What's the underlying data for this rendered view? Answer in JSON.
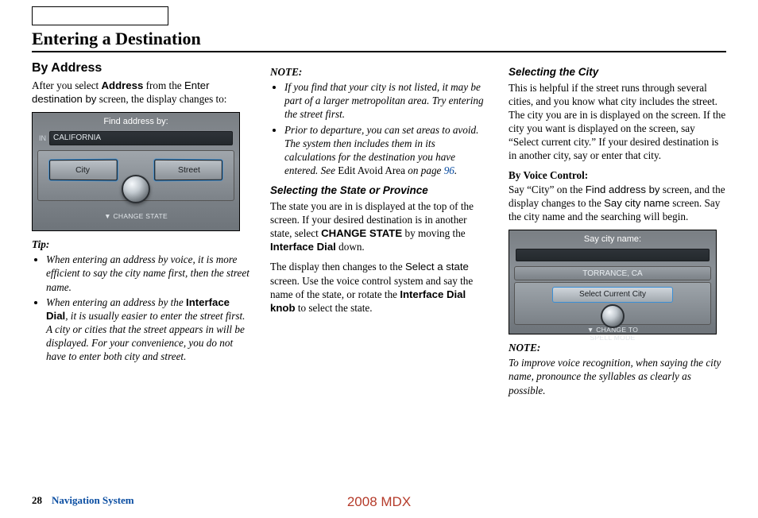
{
  "title": "Entering a Destination",
  "col1": {
    "heading": "By Address",
    "intro_1": "After you select ",
    "intro_bold": "Address",
    "intro_2": " from the ",
    "intro_sans": "Enter destination by",
    "intro_3": " screen, the display changes to:",
    "device": {
      "header": "Find address by:",
      "in_label": "IN",
      "state": "CALIFORNIA",
      "btn_city": "City",
      "btn_street": "Street",
      "footer": "▼ CHANGE STATE"
    },
    "tip_label": "Tip:",
    "tips": [
      "When entering an address by voice, it is more efficient to say the city name first, then the street name.",
      {
        "pre": "When entering an address by the ",
        "bold": "Interface Dial",
        "post": ", it is usually easier to enter the street first. A city or cities that the street appears in will be displayed. For your convenience, you do not have to enter both city and street."
      }
    ]
  },
  "col2": {
    "note_label": "NOTE:",
    "notes": [
      "If you find that your city is not listed, it may be part of a larger metropolitan area. Try entering the street first.",
      {
        "pre": "Prior to departure, you can set areas to avoid. The system then includes them in its calculations for the destination you have entered. See ",
        "roman": "Edit Avoid Area",
        "post_italic": " on page ",
        "link": "96",
        "end": "."
      }
    ],
    "sub1": "Selecting the State or Province",
    "p1_a": "The state you are in is displayed at the top of the screen. If your desired destination is in another state, select ",
    "p1_bold1": "CHANGE STATE",
    "p1_b": " by moving the ",
    "p1_bold2": "Interface Dial",
    "p1_c": " down.",
    "p2_a": "The display then changes to the ",
    "p2_sans": "Select a state",
    "p2_b": " screen. Use the voice control system and say the name of the state, or rotate the ",
    "p2_bold": "Interface Dial knob",
    "p2_c": " to select the state."
  },
  "col3": {
    "sub1": "Selecting the City",
    "p1": "This is helpful if the street runs through several cities, and you know what city includes the street. The city you are in is displayed on the screen. If the city you want is displayed on the screen, say “Select current city.” If your desired destination is in another city, say or enter that city.",
    "voice_head": "By Voice Control:",
    "v_a": "Say “City” on the ",
    "v_sans1": "Find address by",
    "v_b": " screen, and the display changes to the ",
    "v_sans2": "Say city name",
    "v_c": " screen. Say the city name and the searching will begin.",
    "device": {
      "header": "Say city name:",
      "city": "TORRANCE, CA",
      "btn": "Select Current City",
      "footer": "▼ CHANGE TO\nSPELL MODE"
    },
    "note_label": "NOTE:",
    "note": "To improve voice recognition, when saying the city name, pronounce the syllables as clearly as possible."
  },
  "footer": {
    "page": "28",
    "section": "Navigation System",
    "model": "2008 MDX"
  }
}
